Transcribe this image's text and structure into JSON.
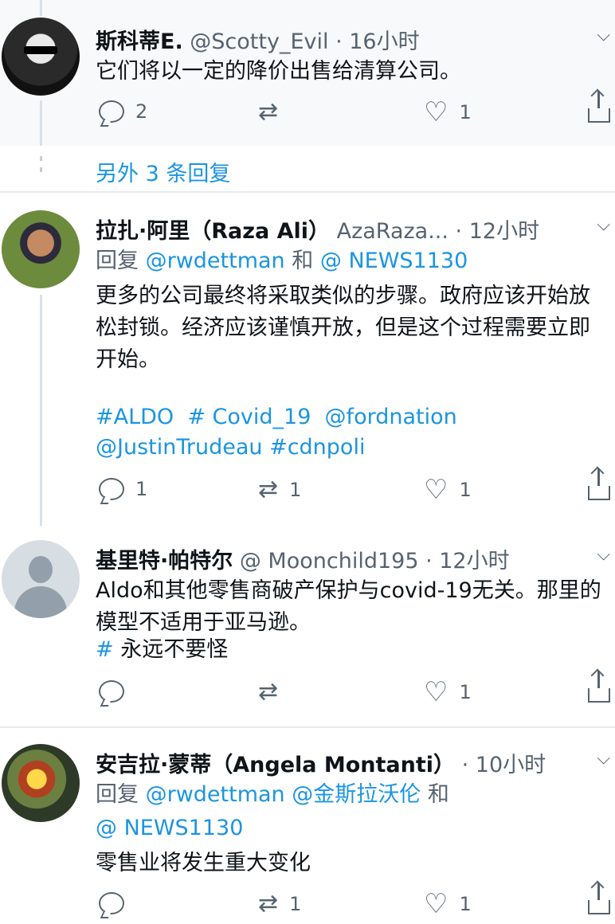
{
  "tweets": [
    {
      "name": "斯科蒂E.",
      "handle": " @Scotty_Evil · 16小时",
      "text": "它们将以一定的降价出售给清算公司。",
      "replies": "2",
      "retweets": "",
      "likes": "1"
    },
    {
      "name": "拉扎·阿里（Raza Ali）",
      "handle": " AzaRaza... · 12小时",
      "reply_label": "回复",
      "reply_to_1": "@rwdettman",
      "reply_and": "和",
      "reply_to_2": "@ NEWS1130",
      "text": "更多的公司最终将采取类似的步骤。政府应该开始放松封锁。经济应该谨慎开放，但是这个过程需要立即开始。",
      "tags_line1": "#ALDO  # Covid_19  @fordnation",
      "tags_line2": "@JustinTrudeau #cdnpoli",
      "replies": "1",
      "retweets": "1",
      "likes": "1"
    },
    {
      "name": "基里特·帕特尔",
      "handle": " @ Moonchild195 · 12小时",
      "text": "Aldo和其他零售商破产保护与covid-19无关。那里的模型不适用于亚马逊。",
      "hashtag": "# ",
      "hashtag_text": "永远不要怪",
      "replies": "",
      "retweets": "",
      "likes": "1"
    },
    {
      "name": "安吉拉·蒙蒂（Angela Montanti）",
      "handle": " · 10小时",
      "reply_label": "回复",
      "reply_to_1": "@rwdettman",
      "reply_to_2": "@金斯拉沃伦",
      "reply_and": "和",
      "reply_to_3": "@ NEWS1130",
      "text": "零售业将发生重大变化",
      "replies": "",
      "retweets": "1",
      "likes": "1"
    }
  ],
  "thread": {
    "more_replies": "另外 3 条回复"
  },
  "icons": {
    "chevron": "chevron-down-icon",
    "reply": "reply-icon",
    "retweet": "retweet-icon",
    "like": "heart-icon",
    "share": "share-icon"
  },
  "colors": {
    "link": "#1b95e0",
    "secondary": "#566370",
    "highlight_bg": "#f7f9fa"
  }
}
